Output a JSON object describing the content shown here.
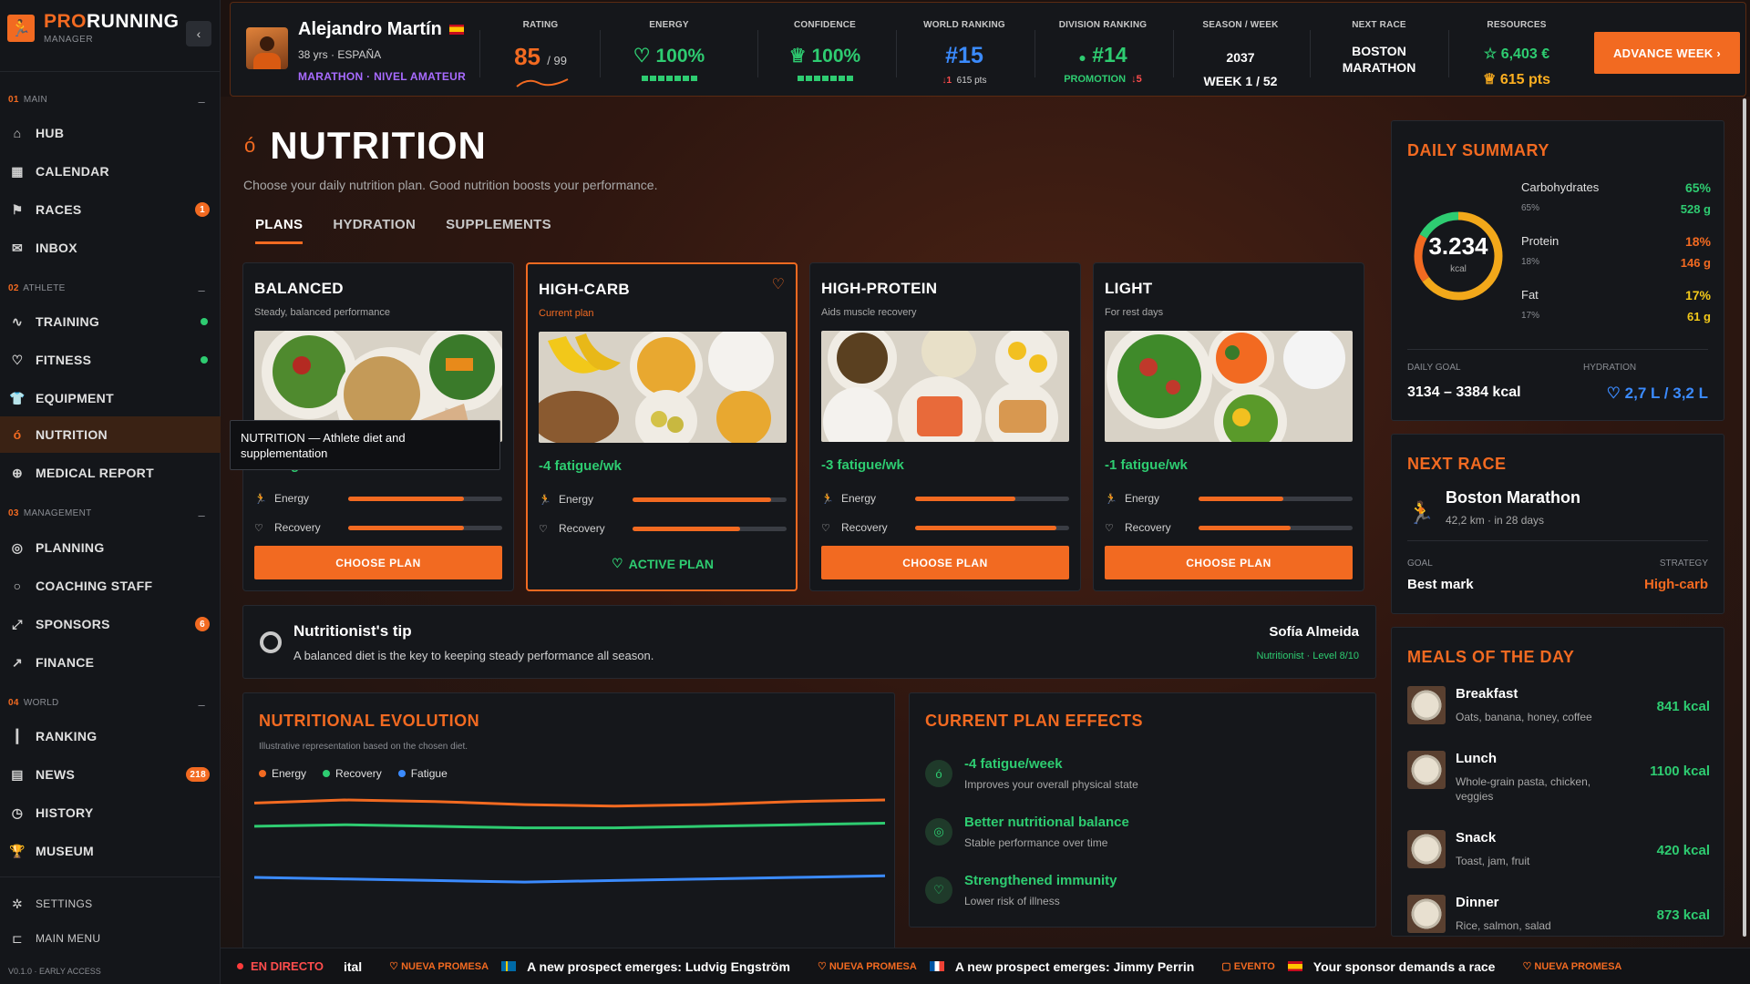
{
  "sidebar": {
    "logo_pro": "PRO",
    "logo_running": "RUNNING",
    "logo_sub": "MANAGER",
    "sections": [
      {
        "num": "01",
        "label": "MAIN"
      },
      {
        "num": "02",
        "label": "ATHLETE"
      },
      {
        "num": "03",
        "label": "MANAGEMENT"
      },
      {
        "num": "04",
        "label": "WORLD"
      }
    ],
    "items": {
      "hub": "HUB",
      "calendar": "CALENDAR",
      "races": "RACES",
      "races_badge": "1",
      "inbox": "INBOX",
      "training": "TRAINING",
      "fitness": "FITNESS",
      "equipment": "EQUIPMENT",
      "nutrition": "NUTRITION",
      "medical": "MEDICAL REPORT",
      "planning": "PLANNING",
      "coaching": "COACHING STAFF",
      "sponsors": "SPONSORS",
      "sponsors_badge": "6",
      "finance": "FINANCE",
      "ranking": "RANKING",
      "news": "NEWS",
      "news_badge": "218",
      "history": "HISTORY",
      "museum": "MUSEUM",
      "settings": "SETTINGS",
      "main_menu": "MAIN MENU"
    },
    "version": "V0.1.0 · EARLY ACCESS"
  },
  "topbar": {
    "player_name": "Alejandro Martín",
    "player_meta": "38 yrs · ESPAÑA",
    "player_level": "MARATHON · NIVEL AMATEUR",
    "rating_label": "RATING",
    "rating": "85",
    "rating_max": "/ 99",
    "energy_label": "ENERGY",
    "energy": "100%",
    "confidence_label": "CONFIDENCE",
    "confidence": "100%",
    "world_label": "WORLD RANKING",
    "world_rank": "#15",
    "world_delta": "↓1",
    "world_pts": "615 pts",
    "division_label": "DIVISION RANKING",
    "division_rank": "#14",
    "division_status": "PROMOTION",
    "division_delta": "↓5",
    "season_label": "SEASON / WEEK",
    "season_year": "2037",
    "season_week": "WEEK 1 / 52",
    "next_race_label": "NEXT RACE",
    "next_race_l1": "BOSTON",
    "next_race_l2": "MARATHON",
    "resources_label": "RESOURCES",
    "money": "6,403 €",
    "points": "615 pts",
    "advance_btn": "ADVANCE WEEK"
  },
  "page": {
    "title": "NUTRITION",
    "subtitle": "Choose your daily nutrition plan. Good nutrition boosts your performance.",
    "tabs": [
      "PLANS",
      "HYDRATION",
      "SUPPLEMENTS"
    ]
  },
  "plans": [
    {
      "title": "BALANCED",
      "sub": "Steady, balanced performance",
      "fatigue": "-2 fatigue/wk",
      "energy_label": "Energy",
      "energy": 0.75,
      "recovery_label": "Recovery",
      "recovery": 0.75,
      "button": "CHOOSE PLAN"
    },
    {
      "title": "HIGH-CARB",
      "sub": "Current plan",
      "fatigue": "-4 fatigue/wk",
      "energy_label": "Energy",
      "energy": 0.9,
      "recovery_label": "Recovery",
      "recovery": 0.7,
      "button": "ACTIVE PLAN"
    },
    {
      "title": "HIGH-PROTEIN",
      "sub": "Aids muscle recovery",
      "fatigue": "-3 fatigue/wk",
      "energy_label": "Energy",
      "energy": 0.65,
      "recovery_label": "Recovery",
      "recovery": 0.92,
      "button": "CHOOSE PLAN"
    },
    {
      "title": "LIGHT",
      "sub": "For rest days",
      "fatigue": "-1 fatigue/wk",
      "energy_label": "Energy",
      "energy": 0.55,
      "recovery_label": "Recovery",
      "recovery": 0.6,
      "button": "CHOOSE PLAN"
    }
  ],
  "tooltip": "NUTRITION — Athlete diet and supplementation",
  "tip": {
    "title": "Nutritionist's tip",
    "text": "A balanced diet is the key to keeping steady performance all season.",
    "name": "Sofía Almeida",
    "role": "Nutritionist · Level 8/10"
  },
  "evolution": {
    "title": "NUTRITIONAL EVOLUTION",
    "note": "Illustrative representation based on the chosen diet.",
    "legend": [
      "Energy",
      "Recovery",
      "Fatigue"
    ]
  },
  "chart_data": {
    "type": "line",
    "title": "NUTRITIONAL EVOLUTION",
    "x": [
      0,
      1,
      2,
      3,
      4,
      5,
      6,
      7
    ],
    "ylim": [
      0,
      100
    ],
    "series": [
      {
        "name": "Energy",
        "color": "#f26a21",
        "values": [
          88,
          90,
          89,
          87,
          86,
          87,
          89,
          90
        ]
      },
      {
        "name": "Recovery",
        "color": "#2ecc71",
        "values": [
          73,
          74,
          73,
          72,
          72,
          73,
          74,
          75
        ]
      },
      {
        "name": "Fatigue",
        "color": "#3b8bff",
        "values": [
          40,
          39,
          38,
          37,
          38,
          39,
          40,
          41
        ]
      }
    ]
  },
  "effects": {
    "title": "CURRENT PLAN EFFECTS",
    "items": [
      {
        "title": "-4 fatigue/week",
        "sub": "Improves your overall physical state"
      },
      {
        "title": "Better nutritional balance",
        "sub": "Stable performance over time"
      },
      {
        "title": "Strengthened immunity",
        "sub": "Lower risk of illness"
      }
    ]
  },
  "summary": {
    "title": "DAILY SUMMARY",
    "kcal": "3.234",
    "unit": "kcal",
    "macros": [
      {
        "name": "Carbohydrates",
        "pct": "65%",
        "grams": "528 g",
        "color": "#f2a81a",
        "fraction": 0.65
      },
      {
        "name": "Protein",
        "pct": "18%",
        "grams": "146 g",
        "color": "#f26a21",
        "fraction": 0.18
      },
      {
        "name": "Fat",
        "pct": "17%",
        "grams": "61 g",
        "color": "#2ecc71",
        "fraction": 0.17
      }
    ],
    "goal_label": "DAILY GOAL",
    "goal": "3134 – 3384 kcal",
    "hydration_label": "HYDRATION",
    "hydration": "2,7 L / 3,2 L"
  },
  "next_race": {
    "title": "NEXT RACE",
    "name": "Boston Marathon",
    "sub": "42,2 km · in 28 days",
    "goal_label": "GOAL",
    "goal": "Best mark",
    "strategy_label": "STRATEGY",
    "strategy": "High-carb"
  },
  "meals": {
    "title": "MEALS OF THE DAY",
    "items": [
      {
        "name": "Breakfast",
        "desc": "Oats, banana, honey, coffee",
        "kcal": "841 kcal"
      },
      {
        "name": "Lunch",
        "desc": "Whole-grain pasta, chicken, veggies",
        "kcal": "1100 kcal"
      },
      {
        "name": "Snack",
        "desc": "Toast, jam, fruit",
        "kcal": "420 kcal"
      },
      {
        "name": "Dinner",
        "desc": "Rice, salmon, salad",
        "kcal": "873 kcal"
      }
    ]
  },
  "ticker": {
    "live": "EN DIRECTO",
    "lead": "ital",
    "items": [
      {
        "tag": "NUEVA PROMESA",
        "text": "A new prospect emerges: Ludvig Engström"
      },
      {
        "tag": "NUEVA PROMESA",
        "text": "A new prospect emerges: Jimmy Perrin"
      },
      {
        "tag": "EVENTO",
        "text": "Your sponsor demands a race"
      },
      {
        "tag": "NUEVA PROMESA",
        "text": ""
      }
    ]
  }
}
